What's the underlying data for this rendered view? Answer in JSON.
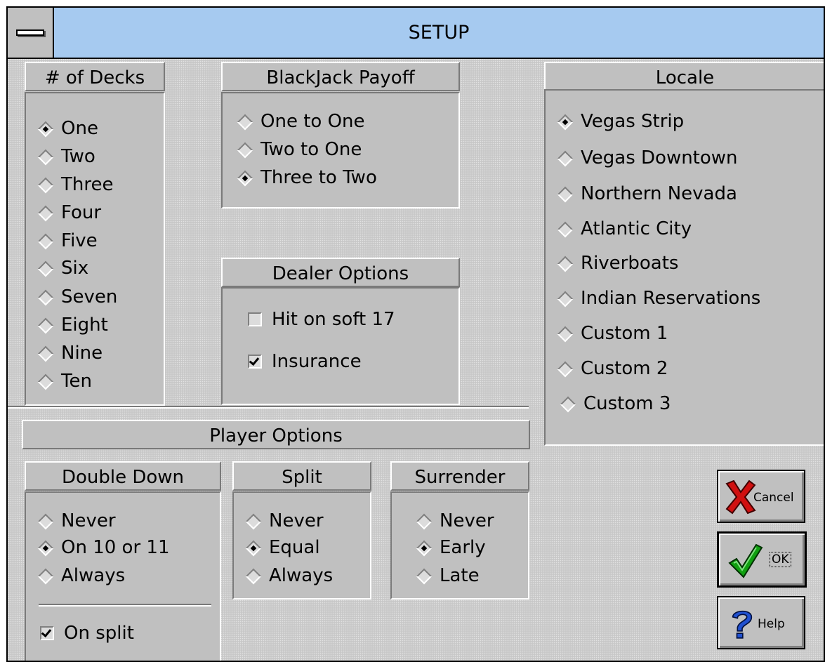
{
  "window": {
    "title": "SETUP"
  },
  "decks": {
    "title": "# of Decks",
    "options": [
      "One",
      "Two",
      "Three",
      "Four",
      "Five",
      "Six",
      "Seven",
      "Eight",
      "Nine",
      "Ten"
    ],
    "selected": "One"
  },
  "payoff": {
    "title": "BlackJack Payoff",
    "options": [
      "One to One",
      "Two to One",
      "Three to Two"
    ],
    "selected": "Three to Two"
  },
  "dealer": {
    "title": "Dealer Options",
    "hit_soft17": {
      "label": "Hit on soft 17",
      "checked": false
    },
    "insurance": {
      "label": "Insurance",
      "checked": true
    }
  },
  "locale": {
    "title": "Locale",
    "options": [
      "Vegas Strip",
      "Vegas Downtown",
      "Northern Nevada",
      "Atlantic City",
      "Riverboats",
      "Indian Reservations",
      "Custom 1",
      "Custom 2",
      "Custom 3"
    ],
    "selected": "Vegas Strip"
  },
  "player": {
    "title": "Player Options",
    "double_down": {
      "title": "Double Down",
      "options": [
        "Never",
        "On 10 or 11",
        "Always"
      ],
      "selected": "On 10 or 11",
      "on_split": {
        "label": "On split",
        "checked": true
      }
    },
    "split": {
      "title": "Split",
      "options": [
        "Never",
        "Equal",
        "Always"
      ],
      "selected": "Equal"
    },
    "surrender": {
      "title": "Surrender",
      "options": [
        "Never",
        "Early",
        "Late"
      ],
      "selected": "Early"
    }
  },
  "buttons": {
    "cancel": "Cancel",
    "ok": "OK",
    "help": "Help"
  },
  "icons": {
    "cancel": "red-x-icon",
    "ok": "green-checkmark-icon",
    "help": "blue-question-mark-icon"
  }
}
